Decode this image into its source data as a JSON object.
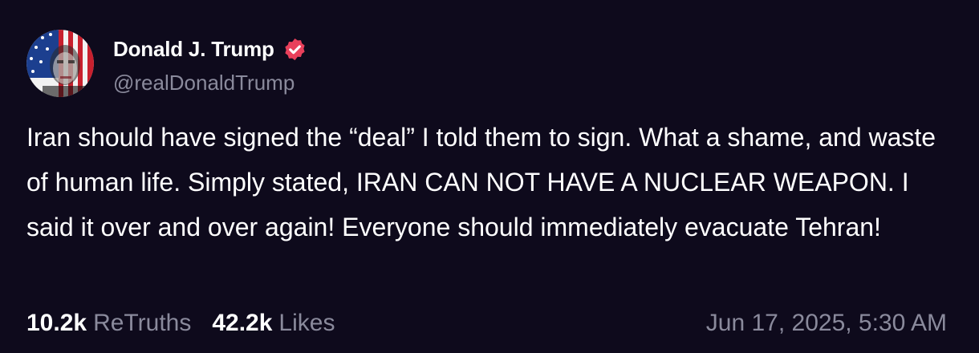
{
  "author": {
    "display_name": "Donald J. Trump",
    "handle": "@realDonaldTrump",
    "verified": true,
    "verified_badge_color": "#e9405b"
  },
  "post": {
    "text": "Iran should have signed the “deal” I told them to sign. What a shame, and waste of human life. Simply stated, IRAN CAN NOT HAVE A NUCLEAR WEAPON. I said it over and over again! Everyone should immediately evacuate Tehran!"
  },
  "stats": {
    "retruths_count": "10.2k",
    "retruths_label": "ReTruths",
    "likes_count": "42.2k",
    "likes_label": "Likes"
  },
  "timestamp": "Jun 17, 2025, 5:30 AM",
  "icons": {
    "avatar": "profile-picture-flag-portrait",
    "verified": "verified-badge-icon"
  },
  "colors": {
    "background": "#0e0a1c",
    "primary_text": "#ffffff",
    "secondary_text": "#8a8a9c"
  }
}
